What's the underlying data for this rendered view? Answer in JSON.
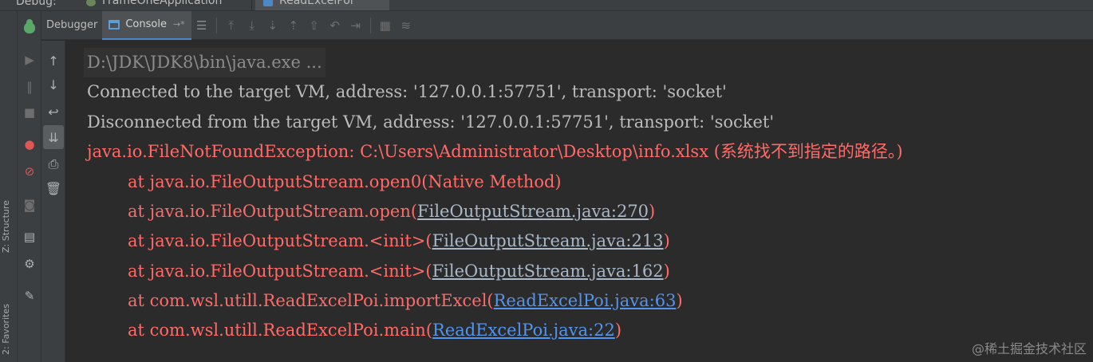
{
  "topbar": {
    "label": "Debug:",
    "tabs": [
      {
        "label": "FrameOneApplication",
        "icon": "spring-app-icon"
      },
      {
        "label": "ReadExcelPoi",
        "icon": "java-class-icon"
      }
    ]
  },
  "toolbar": {
    "debugger_tab": "Debugger",
    "console_tab": "Console",
    "console_pin": "→*",
    "buttons": [
      "menu-icon",
      "show-execution-point-icon",
      "step-over-icon",
      "step-into-icon",
      "force-step-into-icon",
      "step-out-icon",
      "drop-frame-icon",
      "run-to-cursor-icon",
      "evaluate-expression-icon",
      "trace-icon"
    ]
  },
  "left_strip": {
    "labels": [
      "Z: Structure",
      "2: Favorites"
    ]
  },
  "console": {
    "command": "D:\\JDK\\JDK8\\bin\\java.exe ...",
    "connected": "Connected to the target VM, address: '127.0.0.1:57751', transport: 'socket'",
    "disconnected": "Disconnected from the target VM, address: '127.0.0.1:57751', transport: 'socket'",
    "exception": "java.io.FileNotFoundException: C:\\Users\\Administrator\\Desktop\\info.xlsx (系统找不到指定的路径。)",
    "stack": [
      {
        "prefix": "at java.io.FileOutputStream.open0(",
        "link": "",
        "suffix": "Native Method)"
      },
      {
        "prefix": "at java.io.FileOutputStream.open(",
        "link": "FileOutputStream.java:270",
        "suffix": ")"
      },
      {
        "prefix": "at java.io.FileOutputStream.<init>(",
        "link": "FileOutputStream.java:213",
        "suffix": ")"
      },
      {
        "prefix": "at java.io.FileOutputStream.<init>(",
        "link": "FileOutputStream.java:162",
        "suffix": ")"
      },
      {
        "prefix": "at com.wsl.utill.ReadExcelPoi.importExcel(",
        "link": "ReadExcelPoi.java:63",
        "suffix": ")"
      },
      {
        "prefix": "at com.wsl.utill.ReadExcelPoi.main(",
        "link": "ReadExcelPoi.java:22",
        "suffix": ")"
      }
    ]
  },
  "watermark": "@稀土掘金技术社区",
  "colors": {
    "error": "#ff6b68",
    "info": "#bbbbbb",
    "link_jdk": "#a9b7c6",
    "link_project": "#5394ec"
  }
}
